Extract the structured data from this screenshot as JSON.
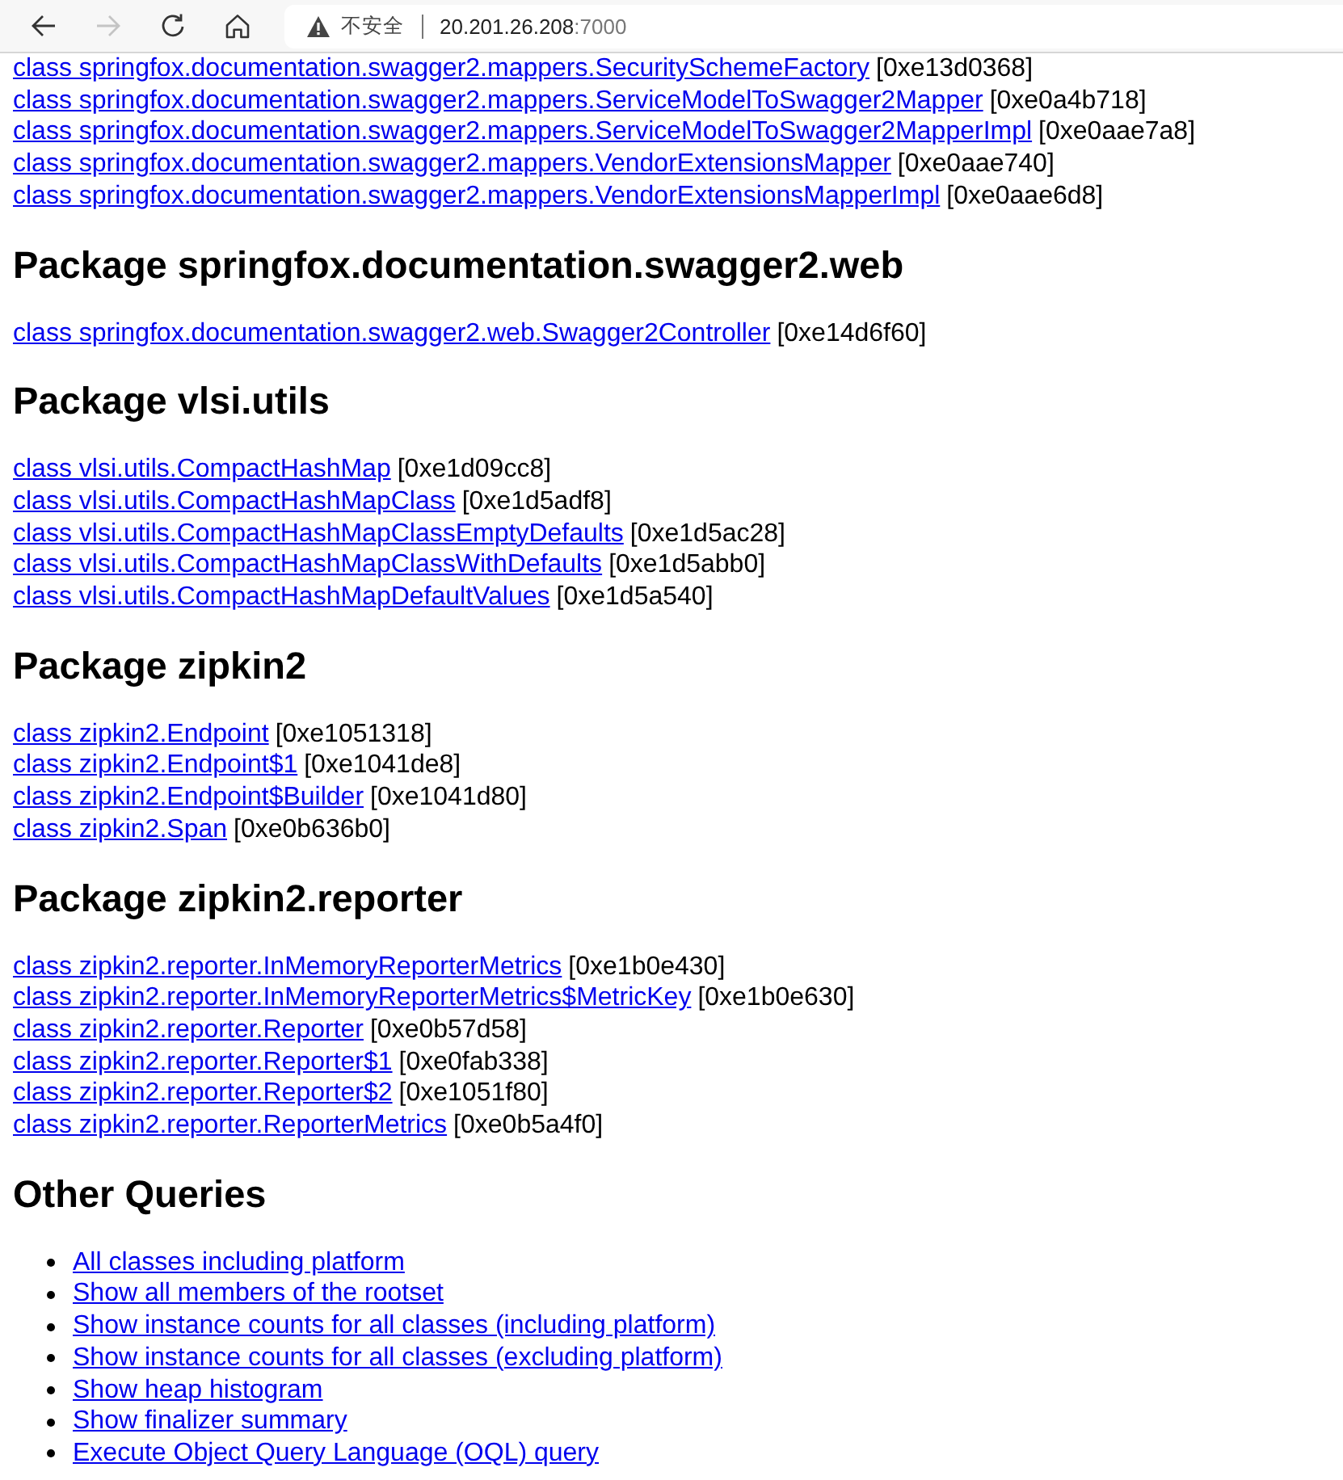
{
  "browser": {
    "nav_buttons": [
      {
        "kind": "back",
        "disabled": false
      },
      {
        "kind": "forward",
        "disabled": true
      },
      {
        "kind": "reload",
        "disabled": false
      },
      {
        "kind": "home",
        "disabled": false
      }
    ],
    "address_bar": {
      "security_label": "不安全",
      "host": "20.201.26.208",
      "port": ":7000"
    }
  },
  "top_classes": [
    {
      "link": "class springfox.documentation.swagger2.mappers.SecuritySchemeFactory",
      "address": "[0xe13d0368]"
    },
    {
      "link": "class springfox.documentation.swagger2.mappers.ServiceModelToSwagger2Mapper",
      "address": "[0xe0a4b718]"
    },
    {
      "link": "class springfox.documentation.swagger2.mappers.ServiceModelToSwagger2MapperImpl",
      "address": "[0xe0aae7a8]"
    },
    {
      "link": "class springfox.documentation.swagger2.mappers.VendorExtensionsMapper",
      "address": "[0xe0aae740]"
    },
    {
      "link": "class springfox.documentation.swagger2.mappers.VendorExtensionsMapperImpl",
      "address": "[0xe0aae6d8]"
    }
  ],
  "packages": [
    {
      "heading": "Package springfox.documentation.swagger2.web",
      "classes": [
        {
          "link": "class springfox.documentation.swagger2.web.Swagger2Controller",
          "address": "[0xe14d6f60]"
        }
      ]
    },
    {
      "heading": "Package vlsi.utils",
      "classes": [
        {
          "link": "class vlsi.utils.CompactHashMap",
          "address": "[0xe1d09cc8]"
        },
        {
          "link": "class vlsi.utils.CompactHashMapClass",
          "address": "[0xe1d5adf8]"
        },
        {
          "link": "class vlsi.utils.CompactHashMapClassEmptyDefaults",
          "address": "[0xe1d5ac28]"
        },
        {
          "link": "class vlsi.utils.CompactHashMapClassWithDefaults",
          "address": "[0xe1d5abb0]"
        },
        {
          "link": "class vlsi.utils.CompactHashMapDefaultValues",
          "address": "[0xe1d5a540]"
        }
      ]
    },
    {
      "heading": "Package zipkin2",
      "classes": [
        {
          "link": "class zipkin2.Endpoint",
          "address": "[0xe1051318]"
        },
        {
          "link": "class zipkin2.Endpoint$1",
          "address": "[0xe1041de8]"
        },
        {
          "link": "class zipkin2.Endpoint$Builder",
          "address": "[0xe1041d80]"
        },
        {
          "link": "class zipkin2.Span",
          "address": "[0xe0b636b0]"
        }
      ]
    },
    {
      "heading": "Package zipkin2.reporter",
      "classes": [
        {
          "link": "class zipkin2.reporter.InMemoryReporterMetrics",
          "address": "[0xe1b0e430]"
        },
        {
          "link": "class zipkin2.reporter.InMemoryReporterMetrics$MetricKey",
          "address": "[0xe1b0e630]"
        },
        {
          "link": "class zipkin2.reporter.Reporter",
          "address": "[0xe0b57d58]"
        },
        {
          "link": "class zipkin2.reporter.Reporter$1",
          "address": "[0xe0fab338]"
        },
        {
          "link": "class zipkin2.reporter.Reporter$2",
          "address": "[0xe1051f80]"
        },
        {
          "link": "class zipkin2.reporter.ReporterMetrics",
          "address": "[0xe0b5a4f0]"
        }
      ]
    }
  ],
  "other_queries": {
    "heading": "Other Queries",
    "items": [
      "All classes including platform",
      "Show all members of the rootset",
      "Show instance counts for all classes (including platform)",
      "Show instance counts for all classes (excluding platform)",
      "Show heap histogram",
      "Show finalizer summary",
      "Execute Object Query Language (OQL) query"
    ]
  }
}
